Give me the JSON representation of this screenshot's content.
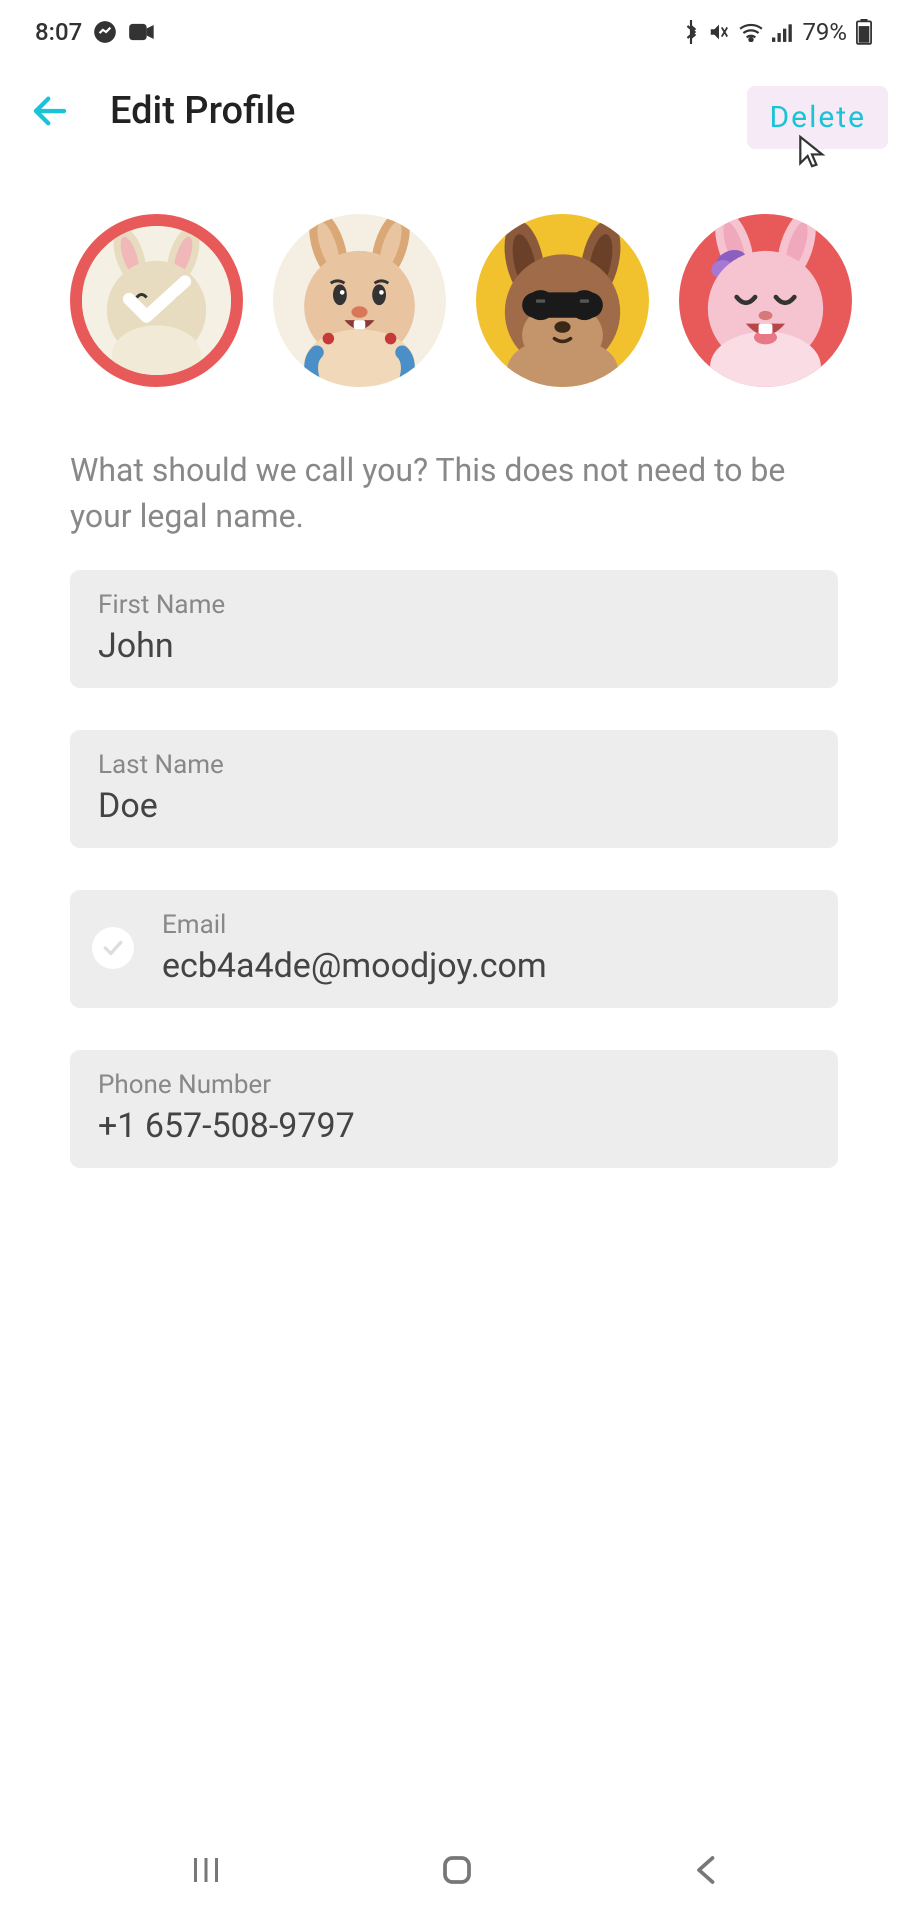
{
  "status": {
    "time": "8:07",
    "battery": "79%"
  },
  "header": {
    "title": "Edit Profile",
    "delete": "Delete"
  },
  "subtitle": "What should we call you? This does not need to be your legal name.",
  "avatars": {
    "selectedIndex": 0,
    "colors": {
      "a1_bg": "#f4f0e4",
      "a1_border": "#e85a5a",
      "a2_bg": "#f5efe3",
      "a3_bg": "#f2c12e",
      "a4_bg": "#e85a5a"
    }
  },
  "fields": {
    "first_name_label": "First Name",
    "first_name_value": "John",
    "last_name_label": "Last Name",
    "last_name_value": "Doe",
    "email_label": "Email",
    "email_value": "ecb4a4de@moodjoy.com",
    "phone_label": "Phone Number",
    "phone_value": "+1 657-508-9797"
  },
  "colors": {
    "accent": "#1bc3d9",
    "field_bg": "#ededed",
    "text_muted": "#888888",
    "text_dark": "#333333"
  }
}
